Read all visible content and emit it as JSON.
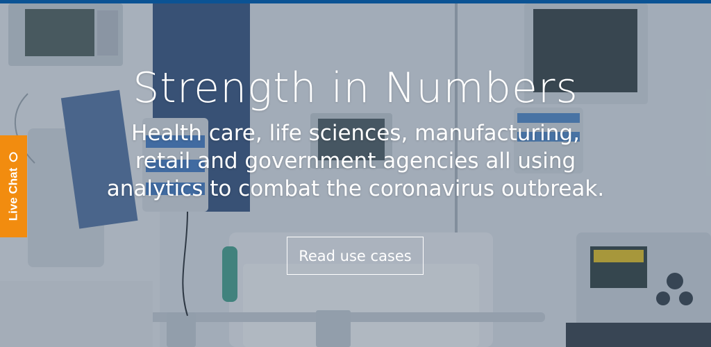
{
  "hero": {
    "title": "Strength in Numbers",
    "subtitle": "Health care, life sciences, manufacturing, retail and government agencies all using analytics to combat the coronavirus outbreak.",
    "cta_label": "Read use cases"
  },
  "live_chat": {
    "label": "Live Chat",
    "icon": "chat-bubble-icon"
  },
  "colors": {
    "top_bar": "#0b5394",
    "live_chat_bg": "#f28c0f",
    "text": "#ffffff"
  }
}
